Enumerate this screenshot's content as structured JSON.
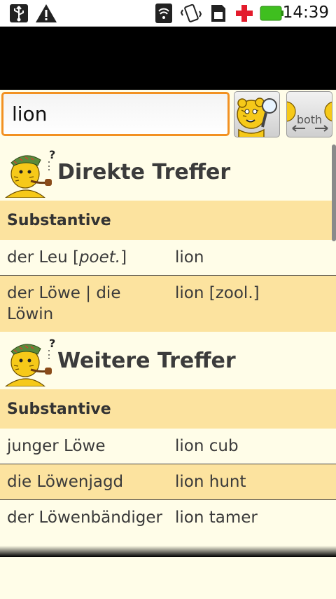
{
  "status_bar": {
    "time": "14:39",
    "icons": [
      "usb-icon",
      "warning-icon",
      "wifi-icon",
      "vibrate-icon",
      "sim-icon",
      "medical-cross-icon",
      "battery-icon"
    ]
  },
  "search": {
    "value": "lion",
    "search_button_icon": "tiger-magnifier-icon",
    "direction_button_label": "both"
  },
  "sections": [
    {
      "title": "Direkte Treffer",
      "category": "Substantive",
      "entries": [
        {
          "de": "der Leu",
          "de_note": "poet.",
          "en": "lion"
        },
        {
          "de": "der Löwe | die Löwin",
          "en": "lion [zool.]"
        }
      ]
    },
    {
      "title": "Weitere Treffer",
      "category": "Substantive",
      "entries": [
        {
          "de": "junger Löwe",
          "en": "lion cub"
        },
        {
          "de": "die Löwenjagd",
          "en": "lion hunt"
        },
        {
          "de": "der Löwenbändiger",
          "en": "lion tamer"
        }
      ]
    }
  ],
  "colors": {
    "accent_border": "#f29122",
    "row_highlight": "#fce39f",
    "background": "#fffde8"
  }
}
